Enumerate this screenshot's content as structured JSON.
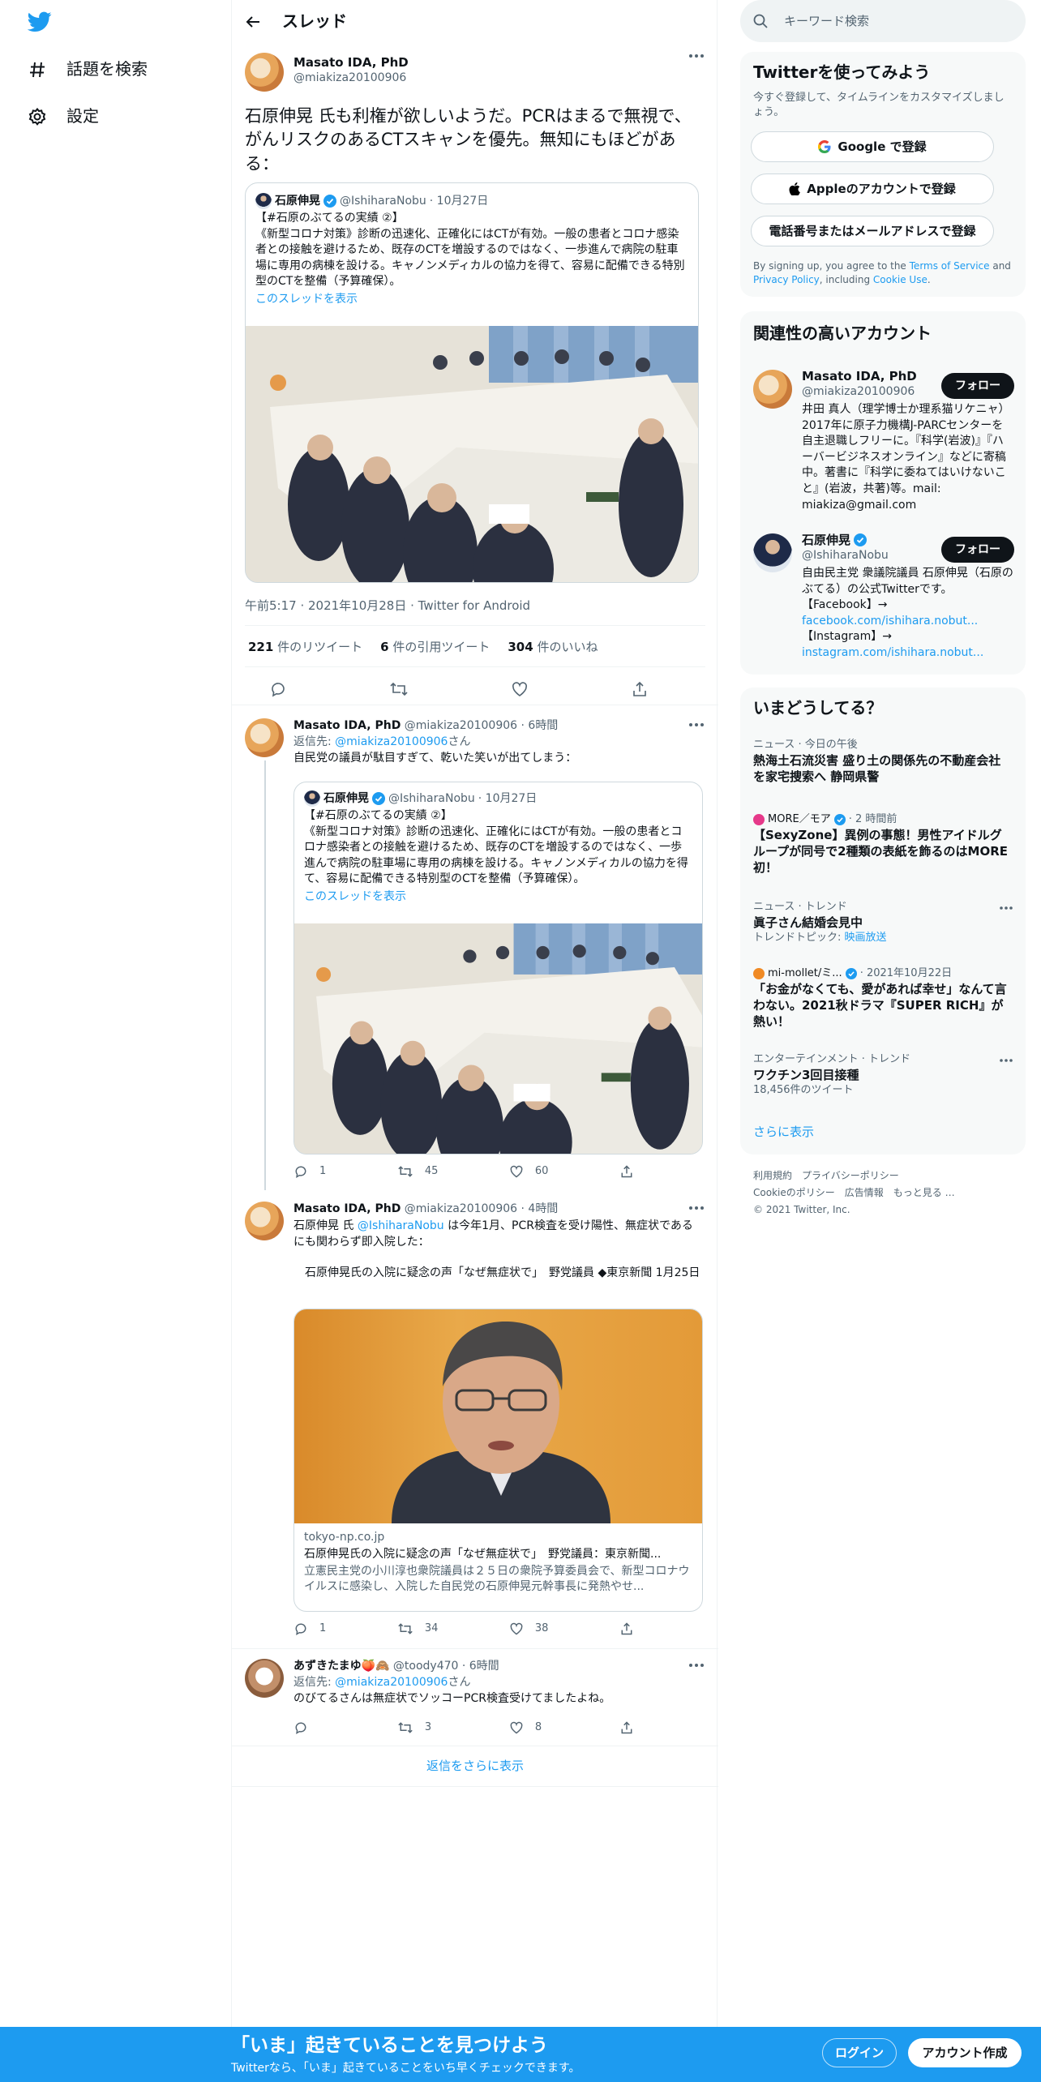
{
  "nav": {
    "explore": "話題を検索",
    "settings": "設定"
  },
  "header": {
    "title": "スレッド"
  },
  "main_tweet": {
    "author_name": "Masato IDA, PhD",
    "author_handle": "@miakiza20100906",
    "text": "石原伸晃 氏も利権が欲しいようだ。PCRはまるで無視で、がんリスクのあるCTスキャンを優先。無知にもほどがある：",
    "quoted": {
      "name": "石原伸晃",
      "handle": "@IshiharaNobu",
      "date": "· 10月27日",
      "text": "【#石原のぶてるの実績 ②】\n《新型コロナ対策》診断の迅速化、正確化にはCTが有効。一般の患者とコロナ感染者との接触を避けるため、既存のCTを増設するのではなく、一歩進んで病院の駐車場に専用の病棟を設ける。キャノンメディカルの協力を得て、容易に配備できる特別型のCTを整備（予算確保）。",
      "show_thread": "このスレッドを表示"
    },
    "timestamp": "午前5:17 · 2021年10月28日 · Twitter for Android",
    "stats": {
      "retweets": "221",
      "retweets_label": "件のリツイート",
      "quotes": "6",
      "quotes_label": "件の引用ツイート",
      "likes": "304",
      "likes_label": "件のいいね"
    }
  },
  "reply1": {
    "author_name": "Masato IDA, PhD",
    "meta": "@miakiza20100906 · 6時間",
    "reply_to_prefix": "返信先: ",
    "reply_to_handle": "@miakiza20100906",
    "reply_to_suffix": "さん",
    "text": "自民党の議員が駄目すぎて、乾いた笑いが出てしまう：",
    "quoted": {
      "name": "石原伸晃",
      "handle": "@IshiharaNobu",
      "date": "· 10月27日",
      "text": "【#石原のぶてるの実績 ②】\n《新型コロナ対策》診断の迅速化、正確化にはCTが有効。一般の患者とコロナ感染者との接触を避けるため、既存のCTを増設するのではなく、一歩進んで病院の駐車場に専用の病棟を設ける。キャノンメディカルの協力を得て、容易に配備できる特別型のCTを整備（予算確保）。",
      "show_thread": "このスレッドを表示"
    },
    "replies": "1",
    "retweets": "45",
    "likes": "60"
  },
  "reply2": {
    "author_name": "Masato IDA, PhD",
    "meta": "@miakiza20100906 · 4時間",
    "text_a": "石原伸晃 氏 ",
    "mention": "@IshiharaNobu",
    "text_b": " は今年1月、PCR検査を受け陽性、無症状であるにも関わらず即入院した：",
    "text_c": "　石原伸晃氏の入院に疑念の声「なぜ無症状で」　野党議員 ◆東京新聞 1月25日",
    "card": {
      "domain": "tokyo-np.co.jp",
      "title": "石原伸晃氏の入院に疑念の声「なぜ無症状で」　野党議員：東京新聞...",
      "desc": "立憲民主党の小川淳也衆院議員は２５日の衆院予算委員会で、新型コロナウイルスに感染し、入院した自民党の石原伸晃元幹事長に発熱やせ..."
    },
    "replies": "1",
    "retweets": "34",
    "likes": "38"
  },
  "reply3": {
    "author_name": "あずきたまゆ🍑🙈",
    "meta": "@toody470 · 6時間",
    "reply_to_prefix": "返信先: ",
    "reply_to_handle": "@miakiza20100906",
    "reply_to_suffix": "さん",
    "text": "のびてるさんは無症状でソッコーPCR検査受けてましたよね。",
    "replies": "",
    "retweets": "3",
    "likes": "8"
  },
  "more_replies": "返信をさらに表示",
  "right": {
    "search_placeholder": "キーワード検索",
    "signup": {
      "title": "Twitterを使ってみよう",
      "subtitle": "今すぐ登録して、タイムラインをカスタマイズしましょう。",
      "google": "Google で登録",
      "apple": "Appleのアカウントで登録",
      "phone": "電話番号またはメールアドレスで登録",
      "legal_a": "By signing up, you agree to the ",
      "tos": "Terms of Service",
      "legal_b": " and ",
      "privacy": "Privacy Policy",
      "legal_c": ", including ",
      "cookie": "Cookie Use",
      "legal_d": "."
    },
    "related": {
      "title": "関連性の高いアカウント",
      "follow": "フォロー",
      "accounts": [
        {
          "name": "Masato IDA, PhD",
          "handle": "@miakiza20100906",
          "bio": "井田 真人（理学博士か理系猫リケニャ） 2017年に原子力機構J-PARCセンターを自主退職しフリーに。『科学(岩波)』『ハーバービジネスオンライン』などに寄稿中。著書に『科学に委ねてはいけないこと』(岩波，共著)等。mail: miakiza@gmail.com"
        },
        {
          "name": "石原伸晃",
          "handle": "@IshiharaNobu",
          "bio": "自由民主党 衆議院議員 石原伸晃（石原のぶてる）の公式Twitterです。\n【Facebook】→",
          "link1": "facebook.com/ishihara.nobut...",
          "bio2": "【Instagram】→",
          "link2": "instagram.com/ishihara.nobut..."
        }
      ]
    },
    "trends": {
      "title": "いまどうしてる？",
      "items": [
        {
          "meta": "ニュース · 今日の午後",
          "title": "熱海土石流災害 盛り土の関係先の不動産会社を家宅捜索へ 静岡県警",
          "sub": ""
        },
        {
          "meta_source": "MORE／モア",
          "meta_time": "· 2 時間前",
          "title": "【SexyZone】異例の事態！男性アイドルグループが同号で2種類の表紙を飾るのはMORE初！",
          "sub": ""
        },
        {
          "meta": "ニュース · トレンド",
          "title": "眞子さん結婚会見中",
          "sub_prefix": "トレンドトピック: ",
          "sub_link": "映画放送"
        },
        {
          "meta_source": "mi-mollet/ミ...",
          "meta_time": "· 2021年10月22日",
          "title": "「お金がなくても、愛があれば幸せ」なんて言わない。2021秋ドラマ『SUPER RICH』が熱い！",
          "sub": ""
        },
        {
          "meta": "エンターテインメント · トレンド",
          "title": "ワクチン3回目接種",
          "sub": "18,456件のツイート"
        }
      ],
      "show_more": "さらに表示"
    },
    "footer": {
      "line1": [
        "利用規約",
        "プライバシーポリシー"
      ],
      "line2": [
        "Cookieのポリシー",
        "広告情報",
        "もっと見る …"
      ],
      "copyright": "© 2021 Twitter, Inc."
    }
  },
  "bottombar": {
    "headline": "「いま」起きていることを見つけよう",
    "sub": "Twitterなら、「いま」起きていることをいち早くチェックできます。",
    "login": "ログイン",
    "signup": "アカウント作成"
  },
  "colors": {
    "accent": "#1d9bf0",
    "text": "#0f1419",
    "muted": "#536471"
  }
}
